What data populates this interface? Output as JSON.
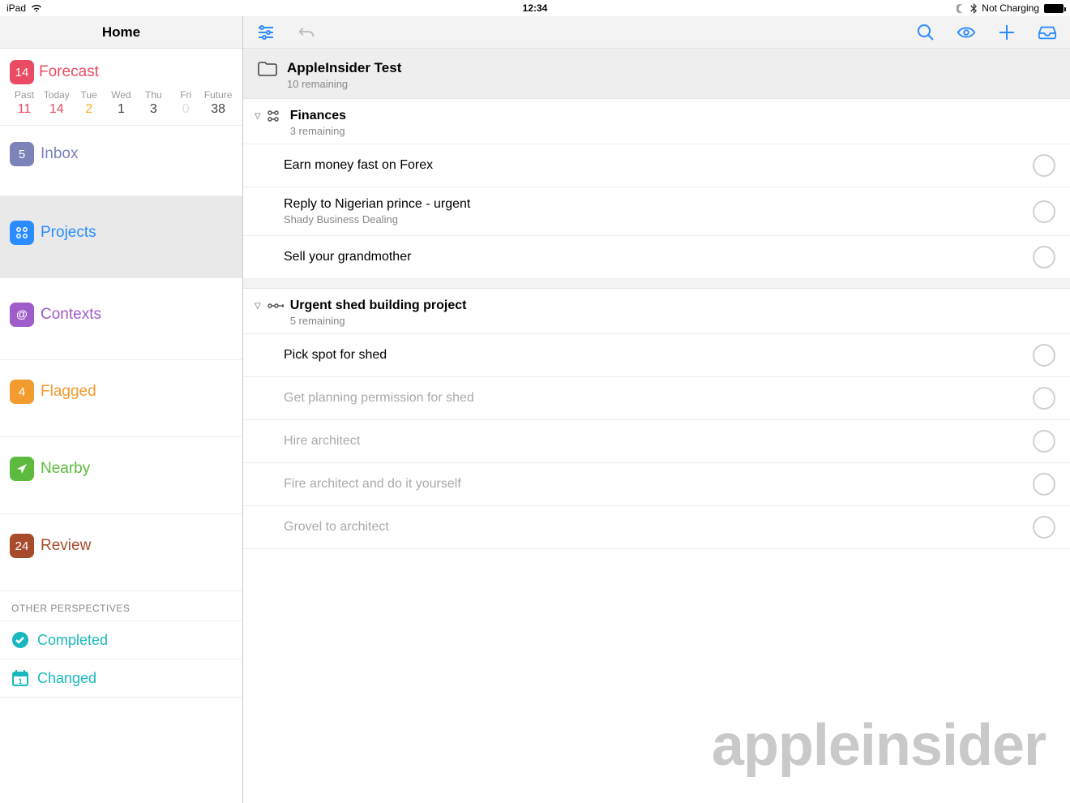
{
  "status": {
    "device": "iPad",
    "time": "12:34",
    "charging": "Not Charging"
  },
  "sidebar": {
    "title": "Home",
    "forecast": {
      "badge": "14",
      "label": "Forecast",
      "days": [
        "Past",
        "Today",
        "Tue",
        "Wed",
        "Thu",
        "Fri",
        "Future"
      ],
      "nums": [
        "11",
        "14",
        "2",
        "1",
        "3",
        "0",
        "38"
      ]
    },
    "items": [
      {
        "badge": "5",
        "label": "Inbox",
        "color": "#7c83b8"
      },
      {
        "badge": "",
        "label": "Projects",
        "color": "#2a8cff"
      },
      {
        "badge": "",
        "label": "Contexts",
        "color": "#a05cc9"
      },
      {
        "badge": "4",
        "label": "Flagged",
        "color": "#f29b2f"
      },
      {
        "badge": "",
        "label": "Nearby",
        "color": "#5cbb3e"
      },
      {
        "badge": "24",
        "label": "Review",
        "color": "#a84b2d"
      }
    ],
    "other_title": "OTHER PERSPECTIVES",
    "other": [
      {
        "label": "Completed",
        "color": "#18b7bd"
      },
      {
        "label": "Changed",
        "color": "#18b7bd"
      }
    ]
  },
  "main": {
    "project": {
      "title": "AppleInsider Test",
      "sub": "10 remaining"
    },
    "groups": [
      {
        "type": "parallel",
        "title": "Finances",
        "sub": "3 remaining",
        "tasks": [
          {
            "text": "Earn money fast on Forex"
          },
          {
            "text": "Reply to Nigerian prince - urgent",
            "sub": "Shady Business Dealing"
          },
          {
            "text": "Sell your grandmother"
          }
        ]
      },
      {
        "type": "sequential",
        "title": "Urgent shed building project",
        "sub": "5 remaining",
        "tasks": [
          {
            "text": "Pick spot for shed"
          },
          {
            "text": "Get planning permission for shed",
            "dim": true
          },
          {
            "text": "Hire architect",
            "dim": true
          },
          {
            "text": "Fire architect and do it yourself",
            "dim": true
          },
          {
            "text": "Grovel to architect",
            "dim": true
          }
        ]
      }
    ]
  },
  "watermark": "appleinsider"
}
